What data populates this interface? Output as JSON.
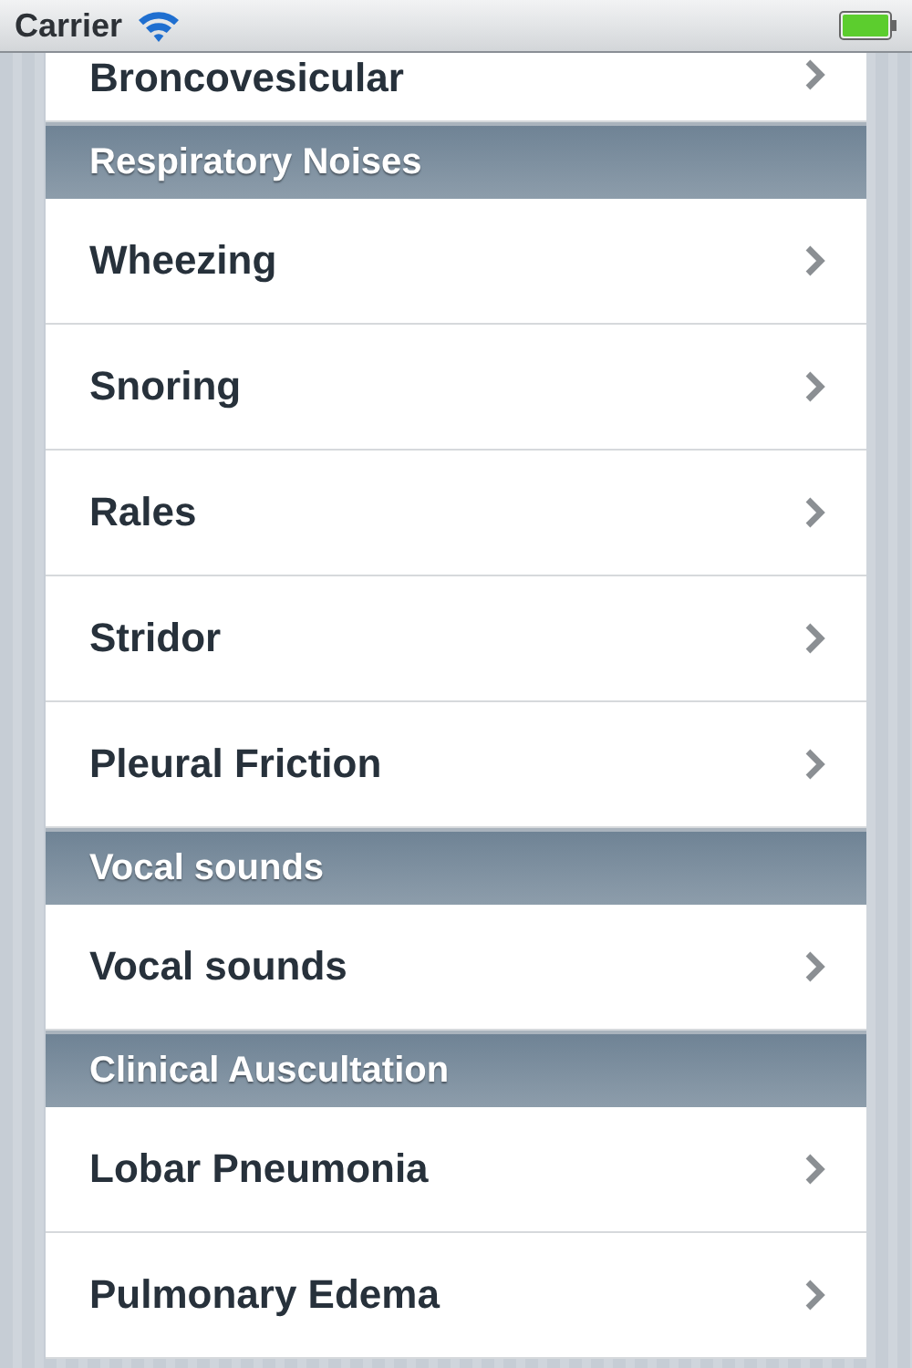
{
  "status_bar": {
    "carrier": "Carrier"
  },
  "sections": [
    {
      "rows": [
        {
          "label": "Broncovesicular"
        }
      ]
    },
    {
      "header": "Respiratory Noises",
      "rows": [
        {
          "label": "Wheezing"
        },
        {
          "label": "Snoring"
        },
        {
          "label": "Rales"
        },
        {
          "label": "Stridor"
        },
        {
          "label": "Pleural Friction"
        }
      ]
    },
    {
      "header": "Vocal sounds",
      "rows": [
        {
          "label": "Vocal sounds"
        }
      ]
    },
    {
      "header": "Clinical Auscultation",
      "rows": [
        {
          "label": "Lobar Pneumonia"
        },
        {
          "label": "Pulmonary Edema"
        }
      ]
    }
  ]
}
